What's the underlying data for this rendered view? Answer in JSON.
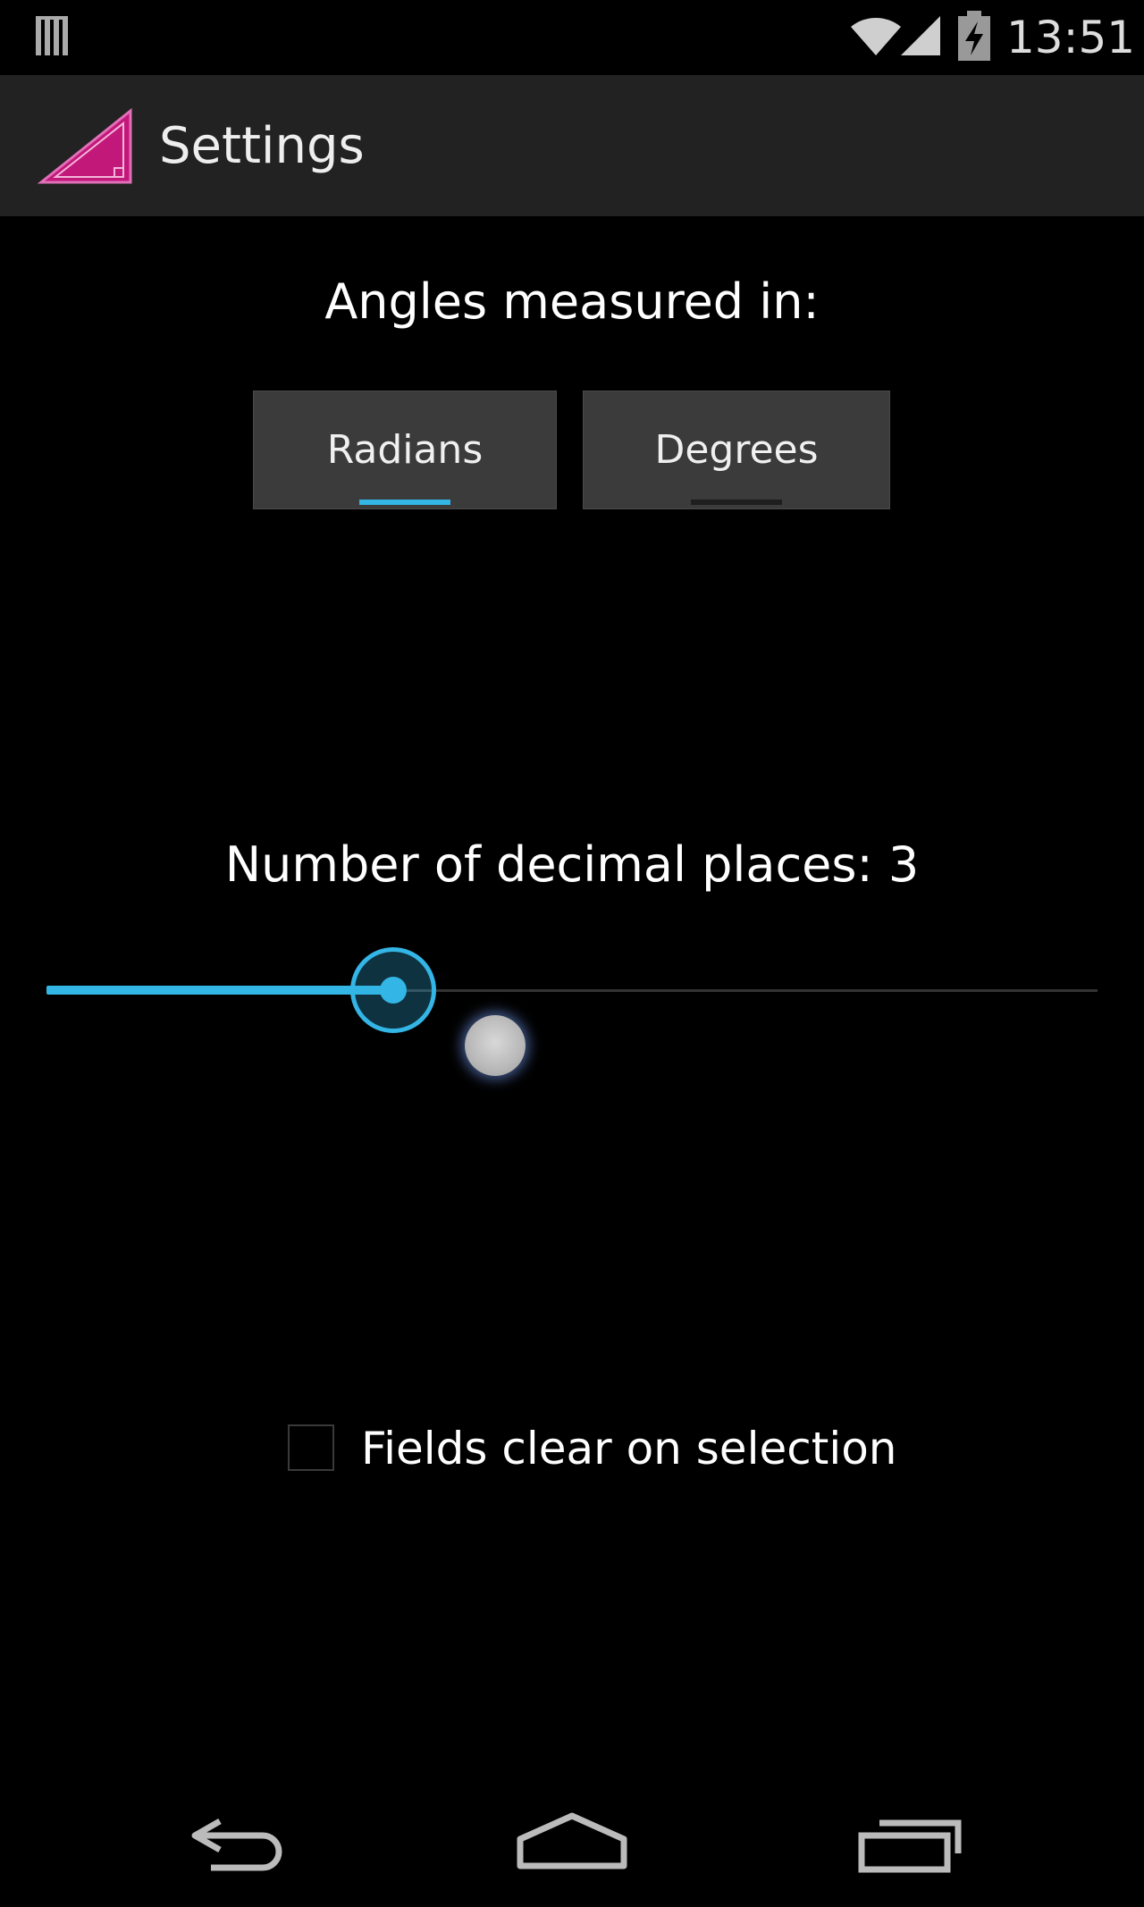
{
  "status_bar": {
    "time": "13:51",
    "icons": [
      "notification-bars-icon",
      "wifi-icon",
      "cell-signal-icon",
      "battery-charging-icon"
    ]
  },
  "action_bar": {
    "title": "Settings",
    "app_icon": "triangle-app-icon",
    "app_icon_color": "#c2187a"
  },
  "angles": {
    "label": "Angles measured in:",
    "options": [
      {
        "label": "Radians",
        "selected": true
      },
      {
        "label": "Degrees",
        "selected": false
      }
    ]
  },
  "decimal_places": {
    "label": "Number of decimal places: 3",
    "value": 3,
    "slider_fraction": 0.33
  },
  "fields_clear": {
    "label": "Fields clear on selection",
    "checked": false
  },
  "nav_bar": {
    "buttons": [
      "back-icon",
      "home-icon",
      "recents-icon"
    ]
  },
  "colors": {
    "accent": "#33b5e5",
    "action_bar_bg": "#222222",
    "button_bg": "#3b3b3b",
    "background": "#000000"
  }
}
